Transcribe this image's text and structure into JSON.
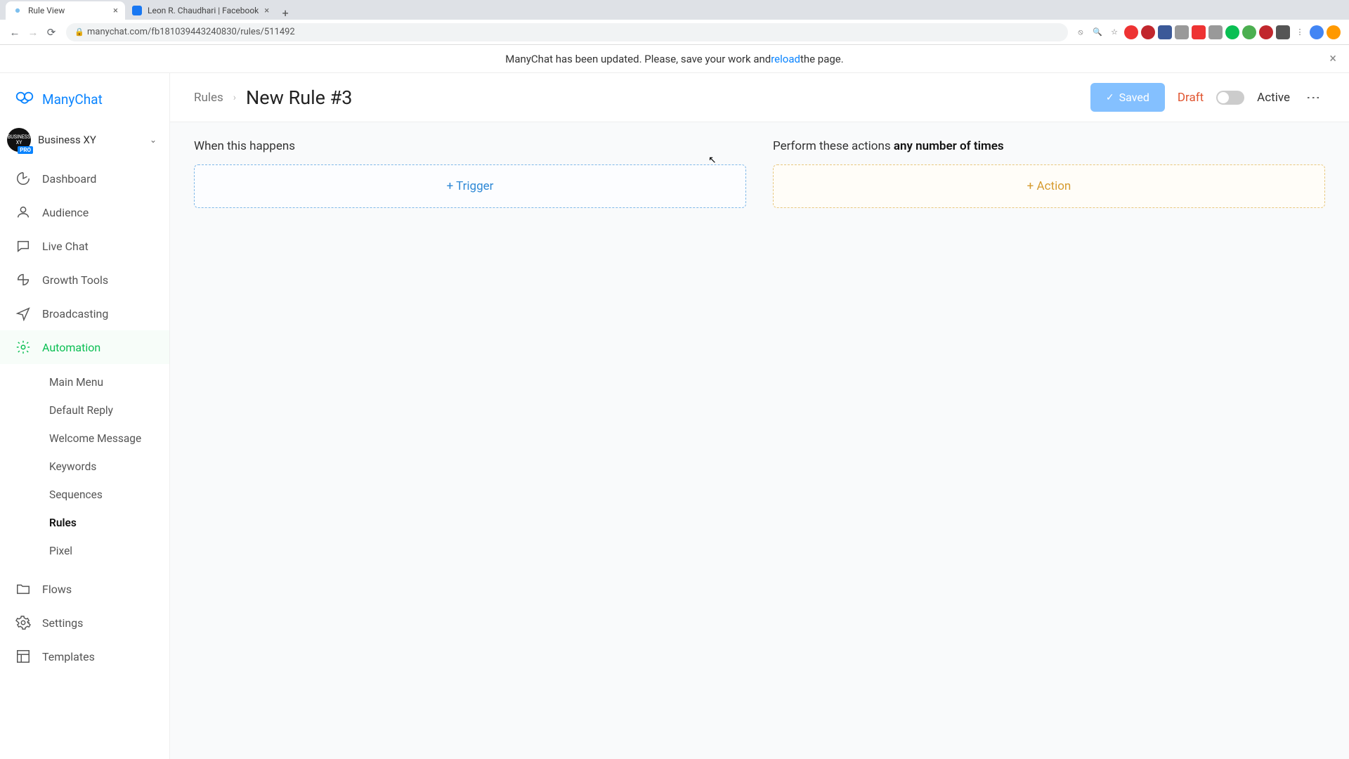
{
  "browser": {
    "tabs": [
      {
        "title": "Rule View",
        "active": true
      },
      {
        "title": "Leon R. Chaudhari | Facebook",
        "active": false
      }
    ],
    "url": "manychat.com/fb181039443240830/rules/511492"
  },
  "notification": {
    "prefix": "ManyChat has been updated. Please, save your work and ",
    "link": "reload",
    "suffix": " the page."
  },
  "logo": {
    "text": "ManyChat"
  },
  "business": {
    "name": "Business XY",
    "badge": "PRO"
  },
  "nav": {
    "items": [
      {
        "label": "Dashboard",
        "icon": "gauge"
      },
      {
        "label": "Audience",
        "icon": "user"
      },
      {
        "label": "Live Chat",
        "icon": "chat"
      },
      {
        "label": "Growth Tools",
        "icon": "growth"
      },
      {
        "label": "Broadcasting",
        "icon": "send"
      },
      {
        "label": "Automation",
        "icon": "automation",
        "active": true
      },
      {
        "label": "Flows",
        "icon": "folder"
      },
      {
        "label": "Settings",
        "icon": "gear"
      },
      {
        "label": "Templates",
        "icon": "template"
      }
    ],
    "automation_sub": [
      {
        "label": "Main Menu"
      },
      {
        "label": "Default Reply"
      },
      {
        "label": "Welcome Message"
      },
      {
        "label": "Keywords"
      },
      {
        "label": "Sequences"
      },
      {
        "label": "Rules",
        "active": true
      },
      {
        "label": "Pixel"
      }
    ]
  },
  "header": {
    "breadcrumb": "Rules",
    "title": "New Rule #3",
    "saved": "Saved",
    "draft": "Draft",
    "active": "Active"
  },
  "content": {
    "trigger_header": "When this happens",
    "trigger_button": "+ Trigger",
    "action_header_pre": "Perform these actions ",
    "action_header_emph": "any number of times",
    "action_button": "+ Action"
  }
}
